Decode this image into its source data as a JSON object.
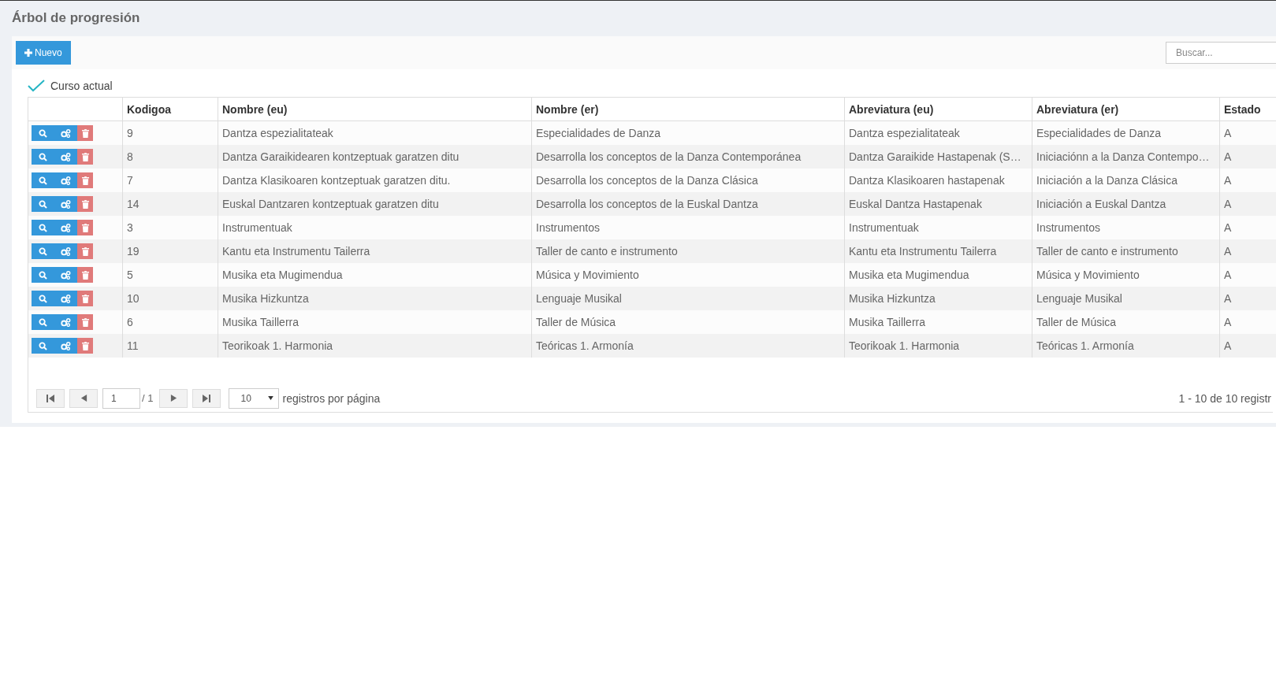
{
  "page": {
    "title": "Árbol de progresión"
  },
  "toolbar": {
    "new_button": "Nuevo",
    "search": {
      "placeholder": "Buscar..."
    }
  },
  "filter": {
    "label": "Curso actual",
    "checked": true
  },
  "table": {
    "columns": [
      "Kodigoa",
      "Nombre (eu)",
      "Nombre (er)",
      "Abreviatura (eu)",
      "Abreviatura (er)",
      "Estado"
    ],
    "rows": [
      [
        "9",
        "Dantza espezialitateak",
        "Especialidades de Danza",
        "Dantza espezialitateak",
        "Especialidades de Danza",
        "A"
      ],
      [
        "8",
        "Dantza Garaikidearen kontzeptuak garatzen ditu",
        "Desarrolla los conceptos de la Danza Contemporánea",
        "Dantza Garaikide Hastapenak (S…",
        "Iniciaciónn a la Danza Contempo…",
        "A"
      ],
      [
        "7",
        "Dantza Klasikoaren kontzeptuak garatzen ditu.",
        "Desarrolla los conceptos de la Danza Clásica",
        "Dantza Klasikoaren hastapenak",
        "Iniciación a la Danza Clásica",
        "A"
      ],
      [
        "14",
        "Euskal Dantzaren kontzeptuak garatzen ditu",
        "Desarrolla los conceptos de la Euskal Dantza",
        "Euskal Dantza Hastapenak",
        "Iniciación a Euskal Dantza",
        "A"
      ],
      [
        "3",
        "Instrumentuak",
        "Instrumentos",
        "Instrumentuak",
        "Instrumentos",
        "A"
      ],
      [
        "19",
        "Kantu eta Instrumentu Tailerra",
        "Taller de canto e instrumento",
        "Kantu eta Instrumentu Tailerra",
        "Taller de canto e instrumento",
        "A"
      ],
      [
        "5",
        "Musika eta Mugimendua",
        "Música y Movimiento",
        "Musika eta Mugimendua",
        "Música y Movimiento",
        "A"
      ],
      [
        "10",
        "Musika Hizkuntza",
        "Lenguaje Musikal",
        "Musika Hizkuntza",
        "Lenguaje Musikal",
        "A"
      ],
      [
        "6",
        "Musika Taillerra",
        "Taller de Música",
        "Musika Taillerra",
        "Taller de Música",
        "A"
      ],
      [
        "11",
        "Teorikoak 1. Harmonia",
        "Teóricas 1. Armonía",
        "Teorikoak 1. Harmonia",
        "Teóricas 1. Armonía",
        "A"
      ]
    ]
  },
  "pager": {
    "page": "1",
    "of_pages": "/ 1",
    "per_page": "10",
    "per_page_label": "registros por página",
    "summary": "1 - 10 de 10 registr"
  }
}
